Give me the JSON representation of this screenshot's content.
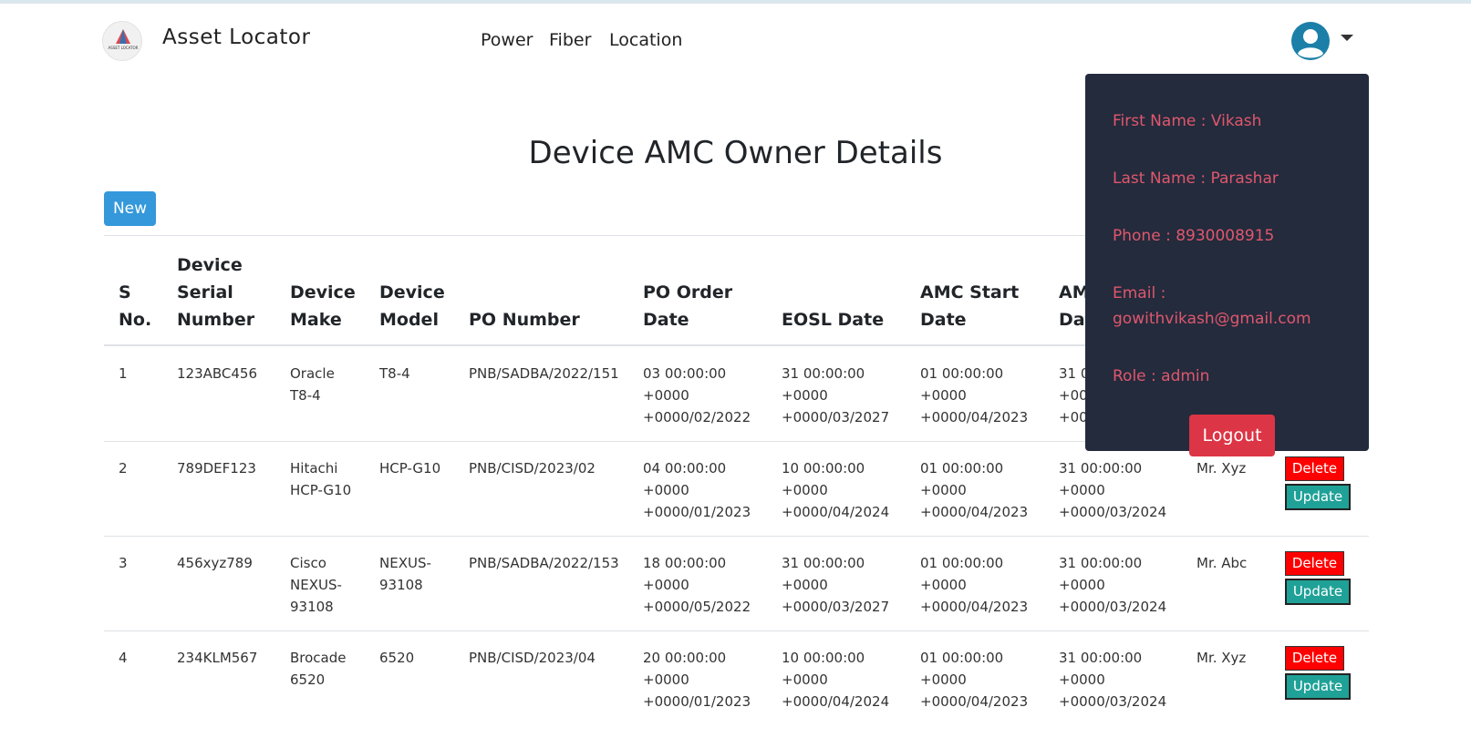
{
  "brand": {
    "name": "Asset Locator",
    "logo_text": "ASSET LOCATOR"
  },
  "nav": {
    "items": [
      "Power",
      "Fiber",
      "Location"
    ]
  },
  "page": {
    "title": "Device AMC Owner Details",
    "new_button": "New"
  },
  "table": {
    "headers": {
      "sno": [
        "S",
        "No."
      ],
      "serial": [
        "Device",
        "Serial",
        "Number"
      ],
      "make": [
        "Device",
        "Make"
      ],
      "model": [
        "Device",
        "Model"
      ],
      "po_number": [
        "PO Number"
      ],
      "po_date": [
        "PO Order",
        "Date"
      ],
      "eosl": [
        "EOSL Date"
      ],
      "amc_start": [
        "AMC Start",
        "Date"
      ],
      "amc_end": [
        "AM",
        "Dat"
      ]
    },
    "rows": [
      {
        "sno": "1",
        "serial": "123ABC456",
        "make": [
          "Oracle",
          "T8-4"
        ],
        "model": [
          "T8-4"
        ],
        "po_number": "PNB/SADBA/2022/151",
        "po_date": [
          "03 00:00:00",
          "+0000",
          "+0000/02/2022"
        ],
        "eosl": [
          "31 00:00:00",
          "+0000",
          "+0000/03/2027"
        ],
        "amc_start": [
          "01 00:00:00",
          "+0000",
          "+0000/04/2023"
        ],
        "amc_end": [
          "31 0",
          "+00",
          "+00"
        ],
        "owner": ""
      },
      {
        "sno": "2",
        "serial": "789DEF123",
        "make": [
          "Hitachi",
          "HCP-G10"
        ],
        "model": [
          "HCP-G10"
        ],
        "po_number": "PNB/CISD/2023/02",
        "po_date": [
          "04 00:00:00",
          "+0000",
          "+0000/01/2023"
        ],
        "eosl": [
          "10 00:00:00",
          "+0000",
          "+0000/04/2024"
        ],
        "amc_start": [
          "01 00:00:00",
          "+0000",
          "+0000/04/2023"
        ],
        "amc_end": [
          "31 00:00:00",
          "+0000",
          "+0000/03/2024"
        ],
        "owner": "Mr. Xyz"
      },
      {
        "sno": "3",
        "serial": "456xyz789",
        "make": [
          "Cisco",
          "NEXUS-",
          "93108"
        ],
        "model": [
          "NEXUS-",
          "93108"
        ],
        "po_number": "PNB/SADBA/2022/153",
        "po_date": [
          "18 00:00:00",
          "+0000",
          "+0000/05/2022"
        ],
        "eosl": [
          "31 00:00:00",
          "+0000",
          "+0000/03/2027"
        ],
        "amc_start": [
          "01 00:00:00",
          "+0000",
          "+0000/04/2023"
        ],
        "amc_end": [
          "31 00:00:00",
          "+0000",
          "+0000/03/2024"
        ],
        "owner": "Mr. Abc"
      },
      {
        "sno": "4",
        "serial": "234KLM567",
        "make": [
          "Brocade",
          "6520"
        ],
        "model": [
          "6520"
        ],
        "po_number": "PNB/CISD/2023/04",
        "po_date": [
          "20 00:00:00",
          "+0000",
          "+0000/01/2023"
        ],
        "eosl": [
          "10 00:00:00",
          "+0000",
          "+0000/04/2024"
        ],
        "amc_start": [
          "01 00:00:00",
          "+0000",
          "+0000/04/2023"
        ],
        "amc_end": [
          "31 00:00:00",
          "+0000",
          "+0000/03/2024"
        ],
        "owner": "Mr. Xyz"
      }
    ],
    "delete_label": "Delete",
    "update_label": "Update"
  },
  "profile": {
    "first_name": "First Name : Vikash",
    "last_name": "Last Name : Parashar",
    "phone": "Phone : 8930008915",
    "email_label": "Email :",
    "email_value": "gowithvikash@gmail.com",
    "role": "Role : admin",
    "logout": "Logout"
  },
  "colors": {
    "new_button": "#3498db",
    "dropdown_bg": "#232b3d",
    "dropdown_text": "#e0576c",
    "logout": "#dc3545",
    "delete": "#ff0000",
    "update": "#20a197"
  },
  "icons": {
    "avatar": "user-avatar-icon",
    "caret": "caret-down-icon",
    "logo": "asset-locator-logo-icon"
  }
}
